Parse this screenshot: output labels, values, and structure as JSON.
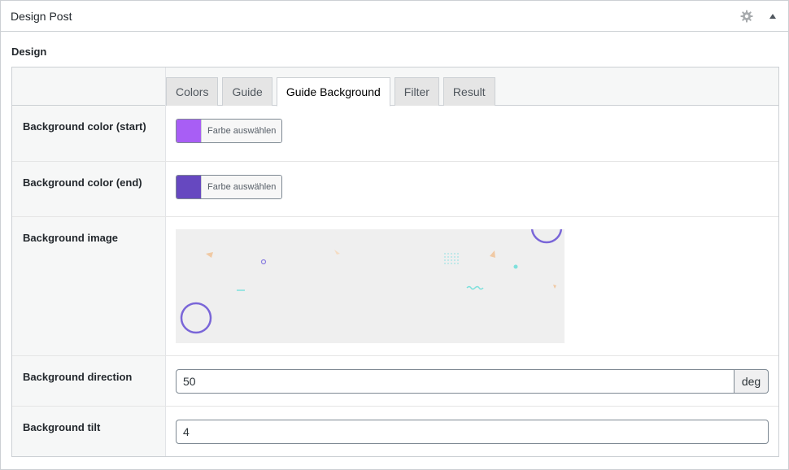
{
  "postbox": {
    "title": "Design Post",
    "settings_icon": "gear-icon",
    "toggle_icon": "triangle-up-icon"
  },
  "section": {
    "label": "Design"
  },
  "tabs": [
    {
      "label": "Colors",
      "active": false
    },
    {
      "label": "Guide",
      "active": false
    },
    {
      "label": "Guide Background",
      "active": true
    },
    {
      "label": "Filter",
      "active": false
    },
    {
      "label": "Result",
      "active": false
    }
  ],
  "fields": {
    "bg_start": {
      "label": "Background color (start)",
      "color": "#a85ef5",
      "button": "Farbe auswählen"
    },
    "bg_end": {
      "label": "Background color (end)",
      "color": "#6648c0",
      "button": "Farbe auswählen"
    },
    "bg_image": {
      "label": "Background image"
    },
    "bg_direction": {
      "label": "Background direction",
      "value": "50",
      "unit": "deg"
    },
    "bg_tilt": {
      "label": "Background tilt",
      "value": "4"
    }
  },
  "colors": {
    "circle": "#7a66d8",
    "triangle": "#f0c9a4",
    "teal": "#7ee0dc"
  }
}
